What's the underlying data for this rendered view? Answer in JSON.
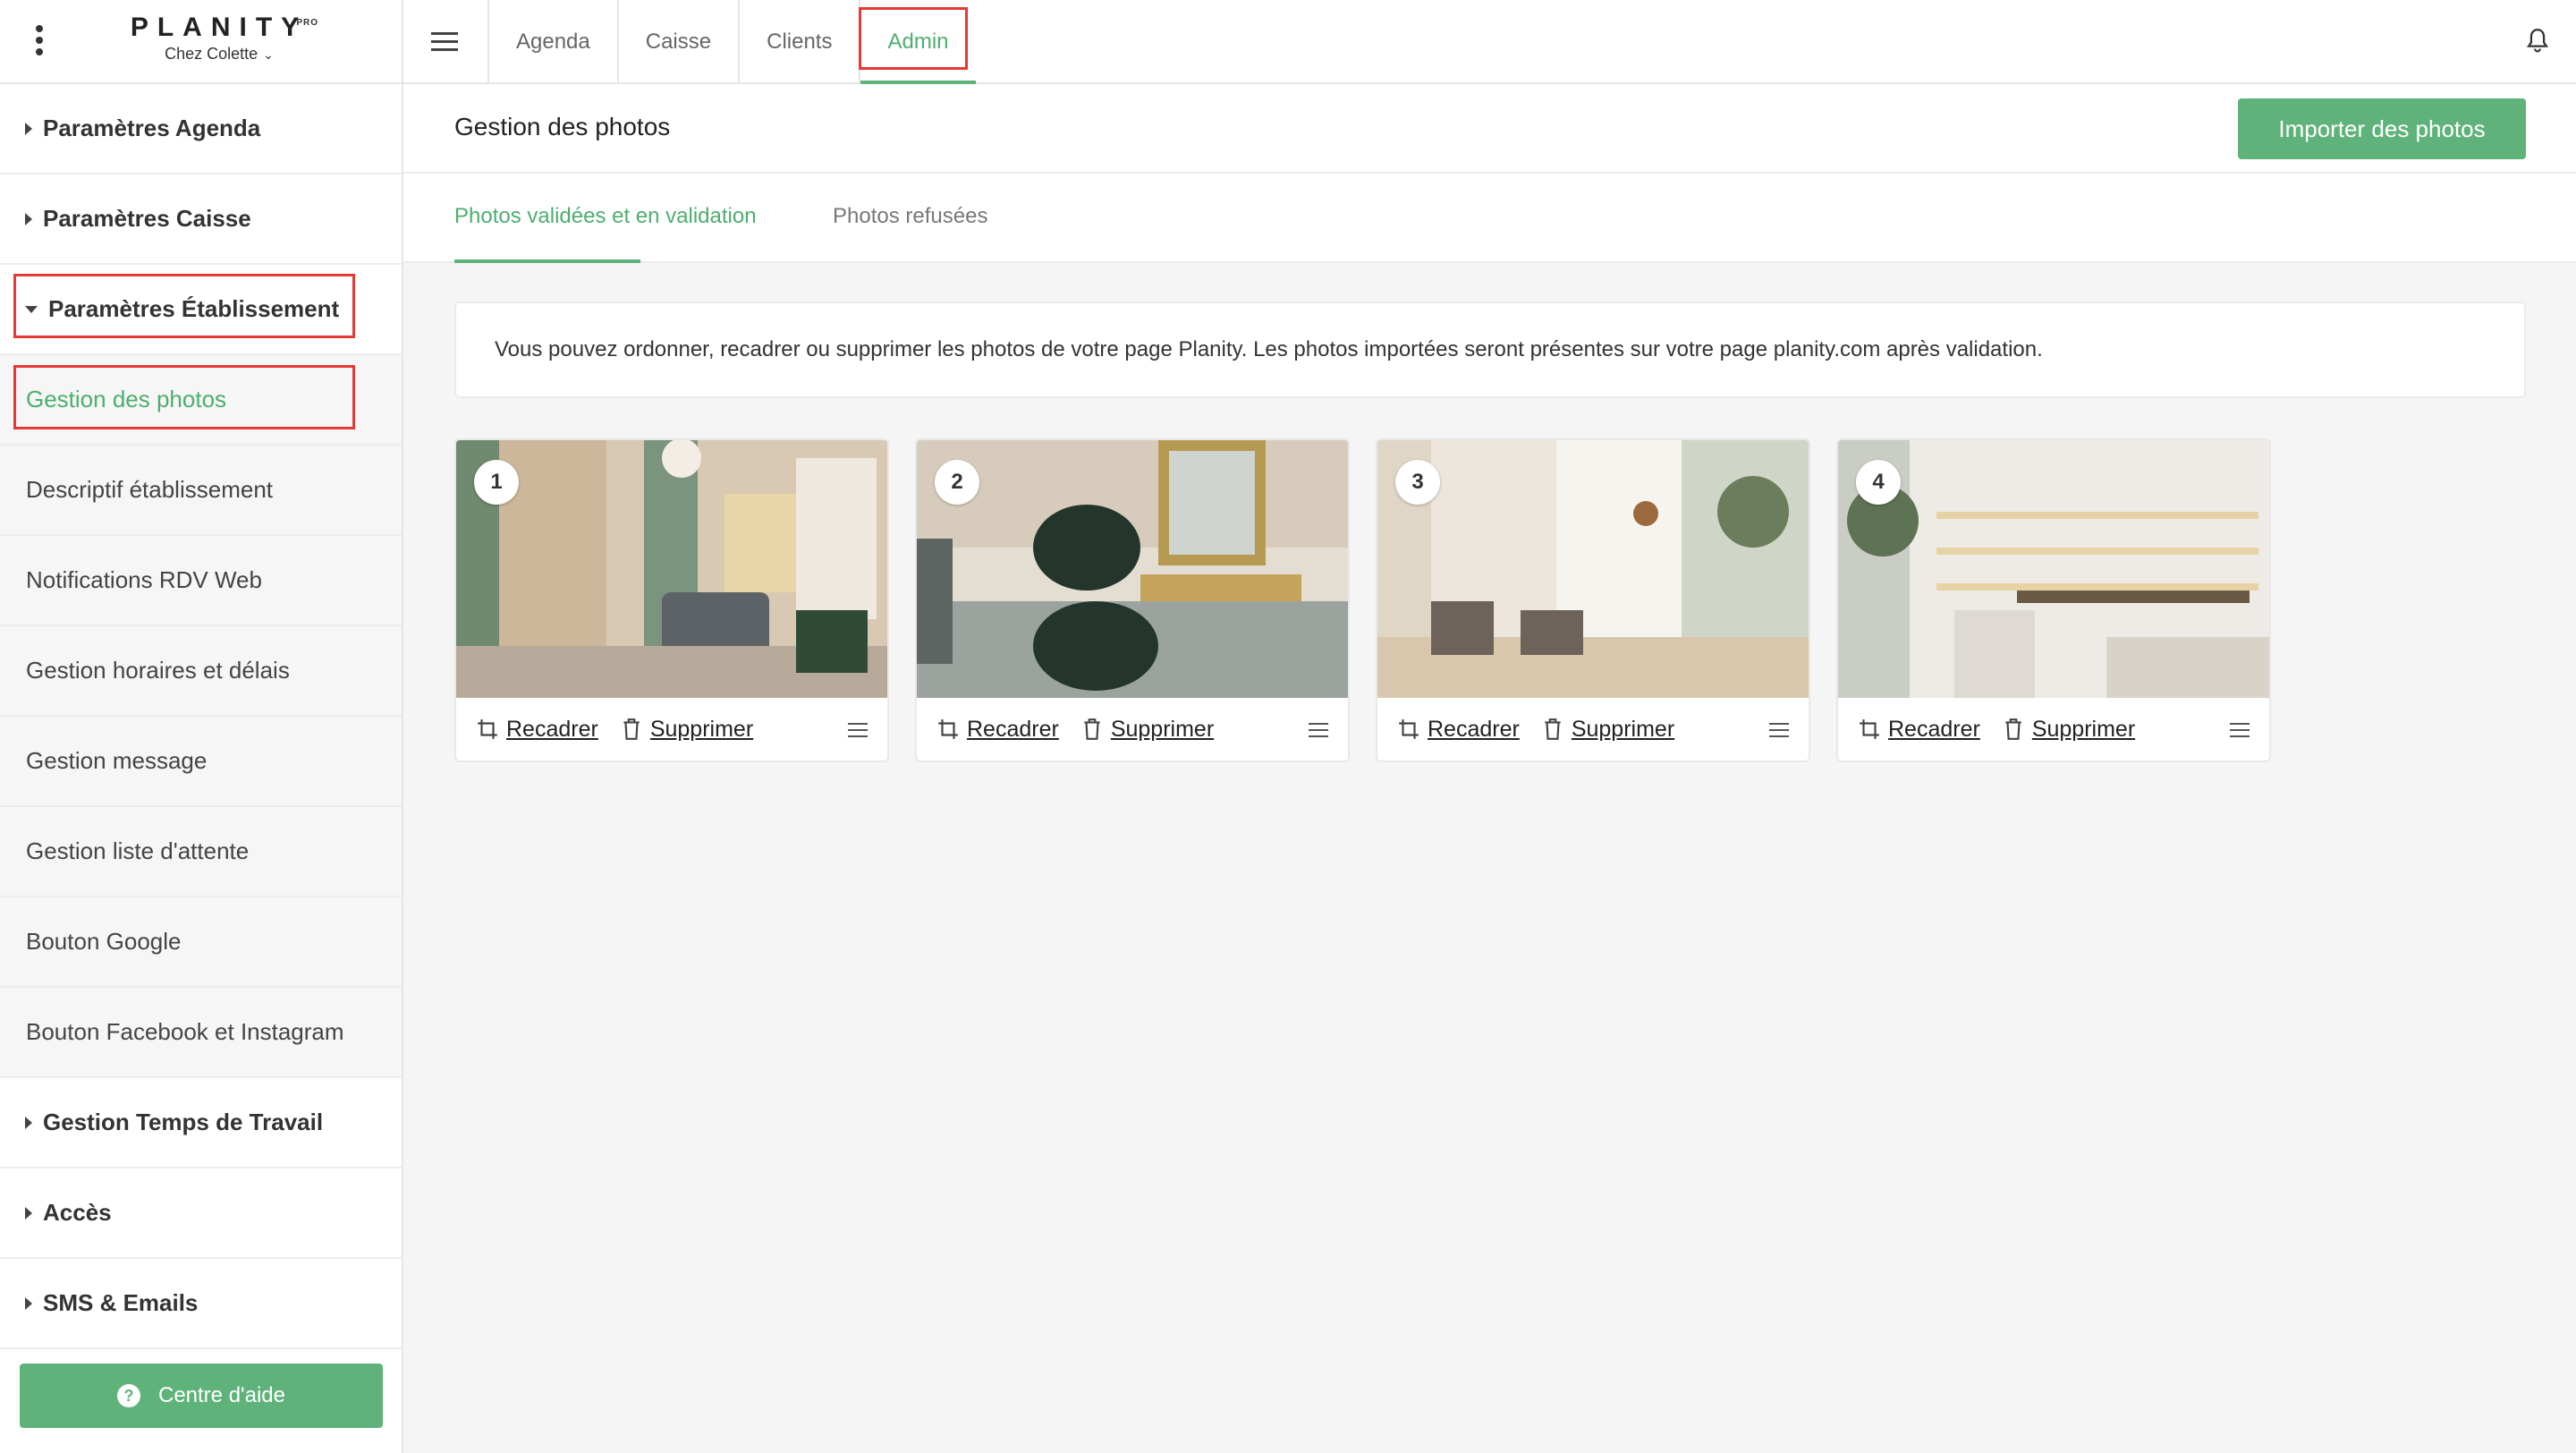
{
  "brand": {
    "name": "PLANITY",
    "badge": "PRO",
    "salon": "Chez Colette"
  },
  "nav": {
    "tabs": [
      {
        "label": "Agenda"
      },
      {
        "label": "Caisse"
      },
      {
        "label": "Clients"
      },
      {
        "label": "Admin"
      }
    ],
    "active": "Admin"
  },
  "sidebar": {
    "items": [
      {
        "label": "Paramètres Agenda"
      },
      {
        "label": "Paramètres Caisse"
      },
      {
        "label": "Paramètres Établissement"
      },
      {
        "label": "Gestion des photos"
      },
      {
        "label": "Descriptif établissement"
      },
      {
        "label": "Notifications RDV Web"
      },
      {
        "label": "Gestion horaires et délais"
      },
      {
        "label": "Gestion message"
      },
      {
        "label": "Gestion liste d'attente"
      },
      {
        "label": "Bouton Google"
      },
      {
        "label": "Bouton Facebook et Instagram"
      },
      {
        "label": "Gestion Temps de Travail"
      },
      {
        "label": "Accès"
      },
      {
        "label": "SMS & Emails"
      }
    ],
    "help_label": "Centre d'aide"
  },
  "page": {
    "title": "Gestion des photos",
    "import_label": "Importer des photos",
    "tabs": [
      {
        "label": "Photos validées et en validation"
      },
      {
        "label": "Photos refusées"
      }
    ],
    "info": "Vous pouvez ordonner, recadrer ou supprimer les photos de votre page Planity. Les photos importées seront présentes sur votre page planity.com après validation."
  },
  "photos": [
    {
      "number": "1",
      "crop_label": "Recadrer",
      "delete_label": "Supprimer"
    },
    {
      "number": "2",
      "crop_label": "Recadrer",
      "delete_label": "Supprimer"
    },
    {
      "number": "3",
      "crop_label": "Recadrer",
      "delete_label": "Supprimer"
    },
    {
      "number": "4",
      "crop_label": "Recadrer",
      "delete_label": "Supprimer"
    }
  ],
  "colors": {
    "accent": "#5fb37a",
    "highlight": "#e53935"
  }
}
